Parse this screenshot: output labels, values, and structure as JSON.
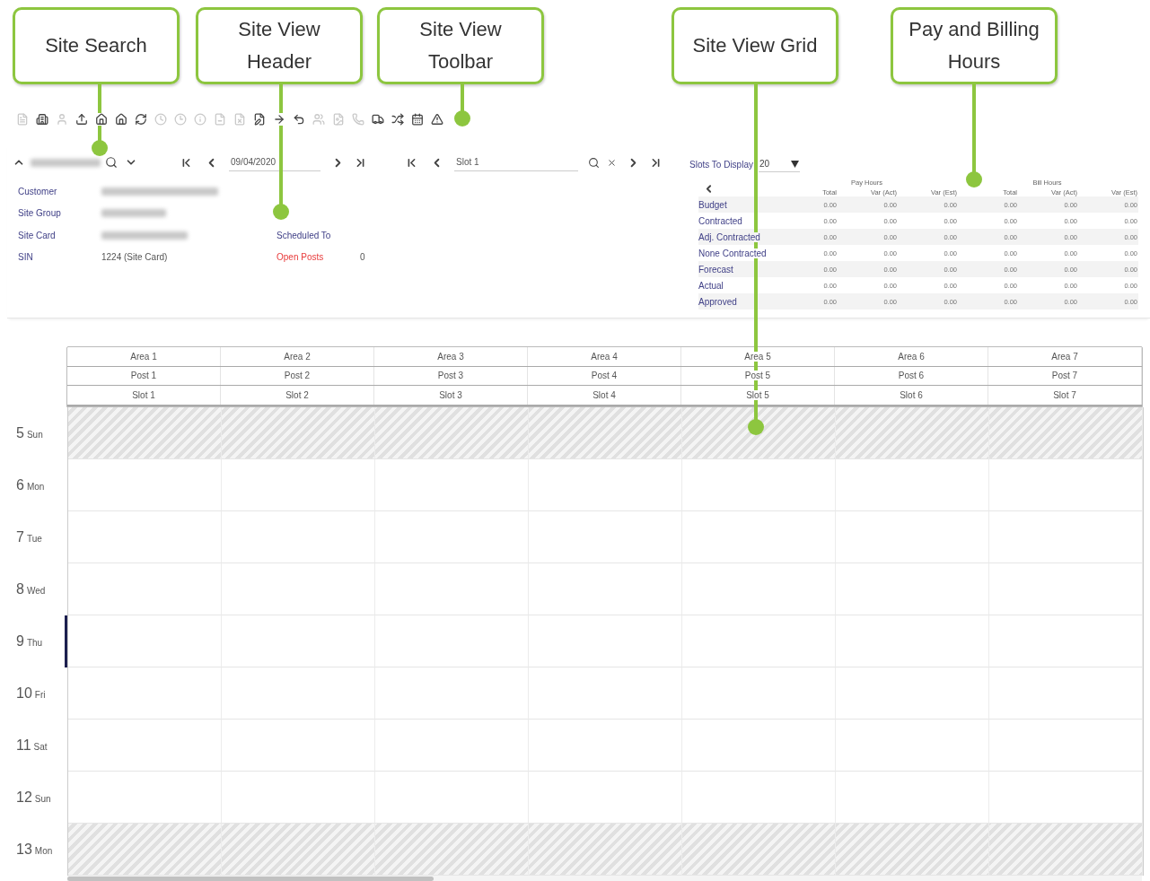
{
  "callouts": [
    {
      "label": "Site Search"
    },
    {
      "label": "Site View Header"
    },
    {
      "label": "Site View Toolbar"
    },
    {
      "label": "Site View Grid"
    },
    {
      "label": "Pay and Billing Hours"
    }
  ],
  "toolbar": [
    {
      "disabled": true
    },
    {
      "disabled": false
    },
    {
      "disabled": true
    },
    {
      "disabled": false
    },
    {
      "disabled": false
    },
    {
      "disabled": false
    },
    {
      "disabled": false
    },
    {
      "disabled": true
    },
    {
      "disabled": true
    },
    {
      "disabled": true
    },
    {
      "disabled": true
    },
    {
      "disabled": true
    },
    {
      "disabled": false
    },
    {
      "disabled": false
    },
    {
      "disabled": false
    },
    {
      "disabled": true
    },
    {
      "disabled": true
    },
    {
      "disabled": true
    },
    {
      "disabled": false
    },
    {
      "disabled": false
    },
    {
      "disabled": false
    },
    {
      "disabled": false
    }
  ],
  "date_navigator": {
    "value": "09/04/2020"
  },
  "slot_navigator": {
    "value": "Slot 1"
  },
  "site_details": [
    {
      "label": "Customer",
      "redacted": true
    },
    {
      "label": "Site Group",
      "redacted": true
    },
    {
      "label": "Site Card",
      "redacted": true
    },
    {
      "label": "SIN",
      "redacted": false,
      "value": "1224 (Site Card)"
    }
  ],
  "schedule": [
    {
      "label": "Scheduled To",
      "alert": false
    },
    {
      "label": "Open Posts",
      "alert": true,
      "value": "0"
    }
  ],
  "slots_to_display": {
    "label": "Slots To Display",
    "value": "20"
  },
  "hours": {
    "groups": [
      "Pay Hours",
      "Bill Hours"
    ],
    "columns": [
      "Total",
      "Var (Act)",
      "Var (Est)",
      "Total",
      "Var (Act)",
      "Var (Est)"
    ],
    "rows": [
      {
        "label": "Budget",
        "values": [
          "0.00",
          "0.00",
          "0.00",
          "0.00",
          "0.00",
          "0.00"
        ]
      },
      {
        "label": "Contracted",
        "values": [
          "0.00",
          "0.00",
          "0.00",
          "0.00",
          "0.00",
          "0.00"
        ]
      },
      {
        "label": "Adj. Contracted",
        "values": [
          "0.00",
          "0.00",
          "0.00",
          "0.00",
          "0.00",
          "0.00"
        ]
      },
      {
        "label": "None Contracted",
        "values": [
          "0.00",
          "0.00",
          "0.00",
          "0.00",
          "0.00",
          "0.00"
        ]
      },
      {
        "label": "Forecast",
        "values": [
          "0.00",
          "0.00",
          "0.00",
          "0.00",
          "0.00",
          "0.00"
        ]
      },
      {
        "label": "Actual",
        "values": [
          "0.00",
          "0.00",
          "0.00",
          "0.00",
          "0.00",
          "0.00"
        ]
      },
      {
        "label": "Approved",
        "values": [
          "0.00",
          "0.00",
          "0.00",
          "0.00",
          "0.00",
          "0.00"
        ]
      }
    ]
  },
  "grid": {
    "areas": [
      "Area 1",
      "Area 2",
      "Area 3",
      "Area 4",
      "Area 5",
      "Area 6",
      "Area 7"
    ],
    "posts": [
      "Post 1",
      "Post 2",
      "Post 3",
      "Post 4",
      "Post 5",
      "Post 6",
      "Post 7"
    ],
    "slots": [
      "Slot 1",
      "Slot 2",
      "Slot 3",
      "Slot 4",
      "Slot 5",
      "Slot 6",
      "Slot 7"
    ],
    "days": [
      {
        "day": "5",
        "weekday": "Sun",
        "shaded": true,
        "current": false
      },
      {
        "day": "6",
        "weekday": "Mon",
        "shaded": false,
        "current": false
      },
      {
        "day": "7",
        "weekday": "Tue",
        "shaded": false,
        "current": false
      },
      {
        "day": "8",
        "weekday": "Wed",
        "shaded": false,
        "current": false
      },
      {
        "day": "9",
        "weekday": "Thu",
        "shaded": false,
        "current": true
      },
      {
        "day": "10",
        "weekday": "Fri",
        "shaded": false,
        "current": false
      },
      {
        "day": "11",
        "weekday": "Sat",
        "shaded": false,
        "current": false
      },
      {
        "day": "12",
        "weekday": "Sun",
        "shaded": false,
        "current": false
      },
      {
        "day": "13",
        "weekday": "Mon",
        "shaded": true,
        "current": false
      }
    ]
  }
}
